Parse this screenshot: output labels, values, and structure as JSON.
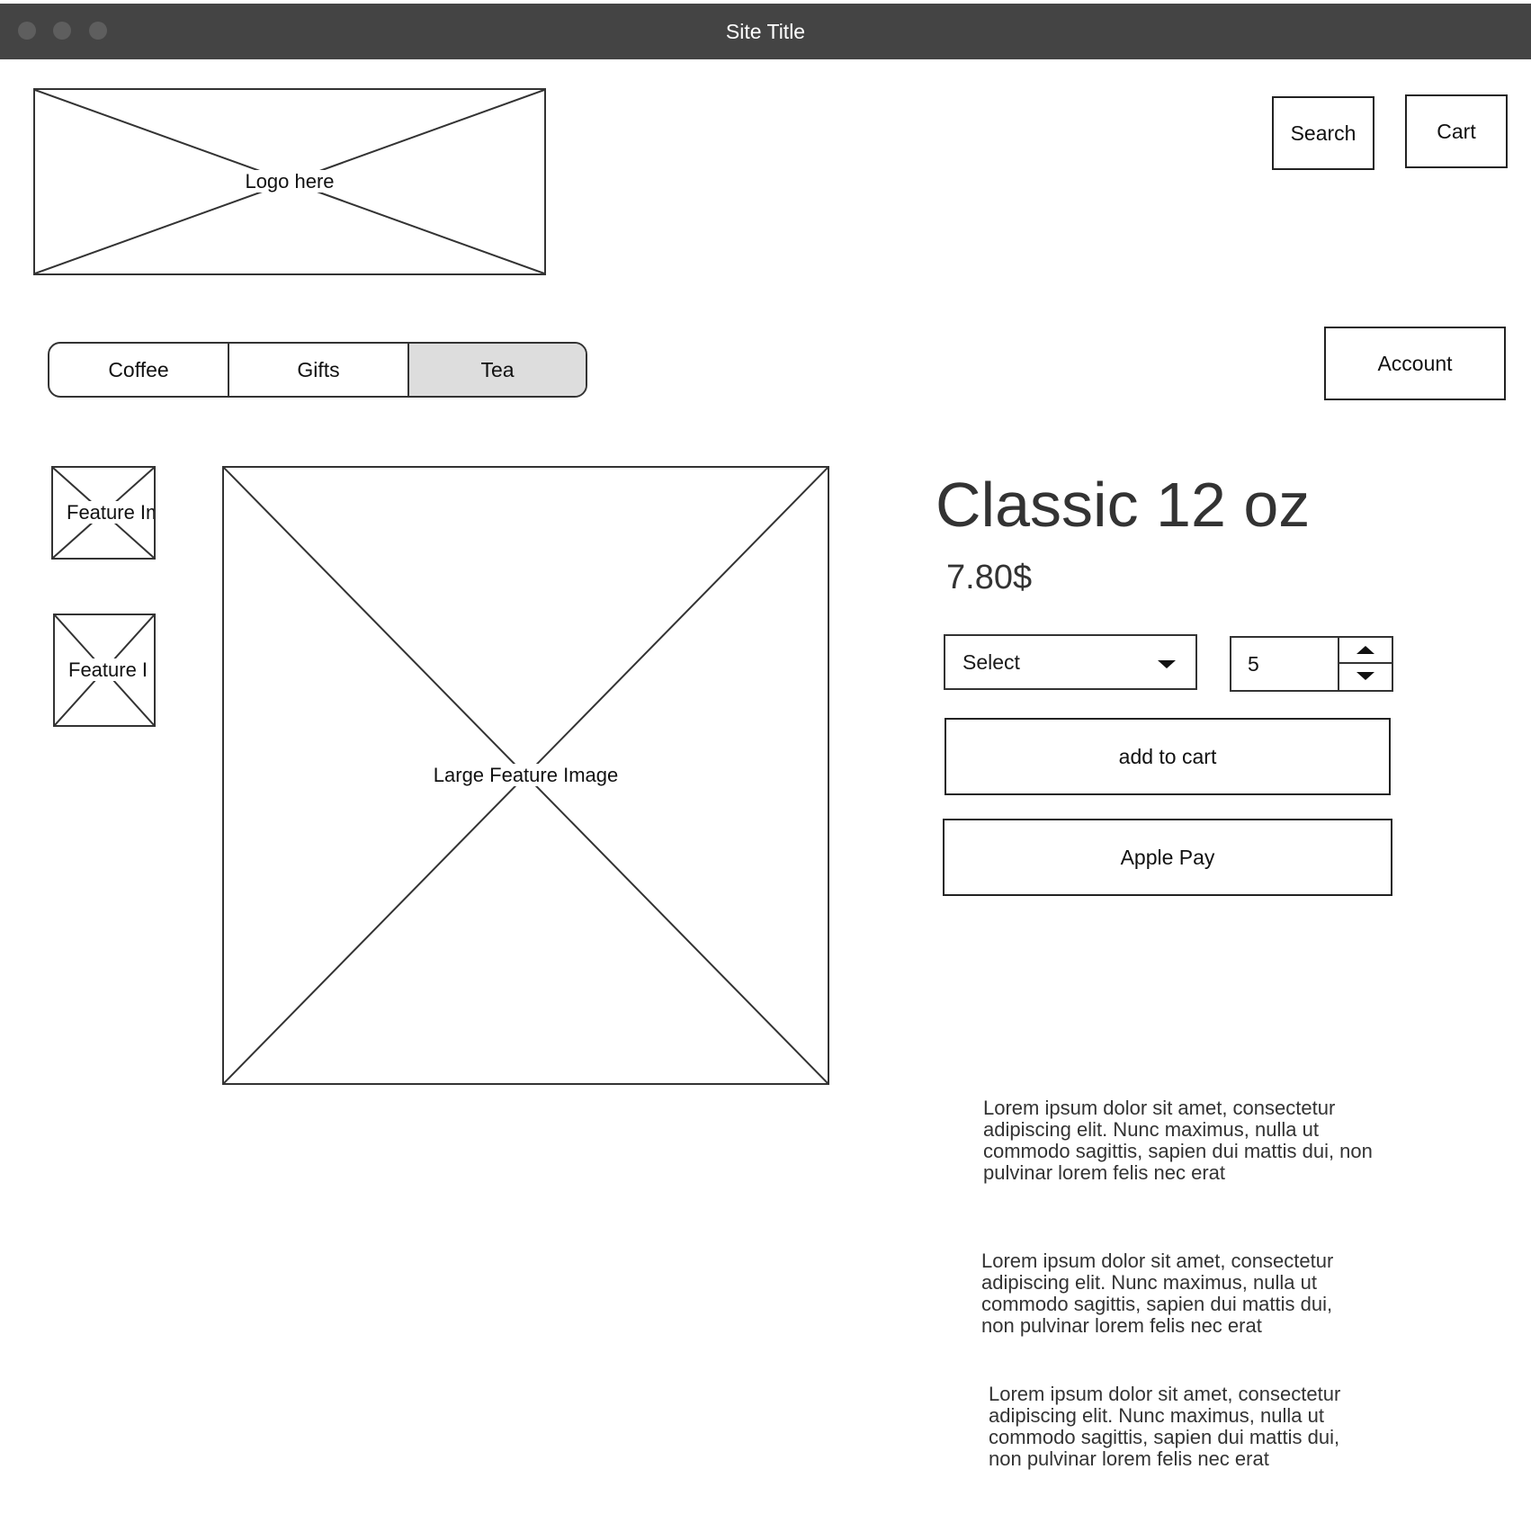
{
  "window": {
    "title": "Site Title",
    "dot_color": "#5e5e5e",
    "bar_color": "#444444"
  },
  "header": {
    "logo_label": "Logo here",
    "search_label": "Search",
    "cart_label": "Cart",
    "account_label": "Account"
  },
  "nav": {
    "tabs": [
      {
        "label": "Coffee",
        "active": false
      },
      {
        "label": "Gifts",
        "active": false
      },
      {
        "label": "Tea",
        "active": true
      }
    ],
    "active_color": "#dddddd"
  },
  "gallery": {
    "thumb_1_label": "Feature Ima",
    "thumb_2_label": "Feature I",
    "large_label": "Large Feature Image"
  },
  "product": {
    "title": "Classic 12 oz",
    "price": "7.80$",
    "select_label": "Select",
    "quantity": "5",
    "add_to_cart_label": "add to cart",
    "apple_pay_label": "Apple Pay"
  },
  "descriptions": [
    "Lorem ipsum dolor sit amet, consectetur adipiscing elit. Nunc maximus, nulla ut commodo sagittis, sapien dui mattis dui, non pulvinar lorem felis nec erat",
    "Lorem ipsum dolor sit amet, consectetur adipiscing elit. Nunc maximus, nulla ut commodo sagittis, sapien dui mattis dui, non pulvinar lorem felis nec erat",
    "Lorem ipsum dolor sit amet, consectetur adipiscing elit. Nunc maximus, nulla ut commodo sagittis, sapien dui mattis dui, non pulvinar lorem felis nec erat"
  ]
}
